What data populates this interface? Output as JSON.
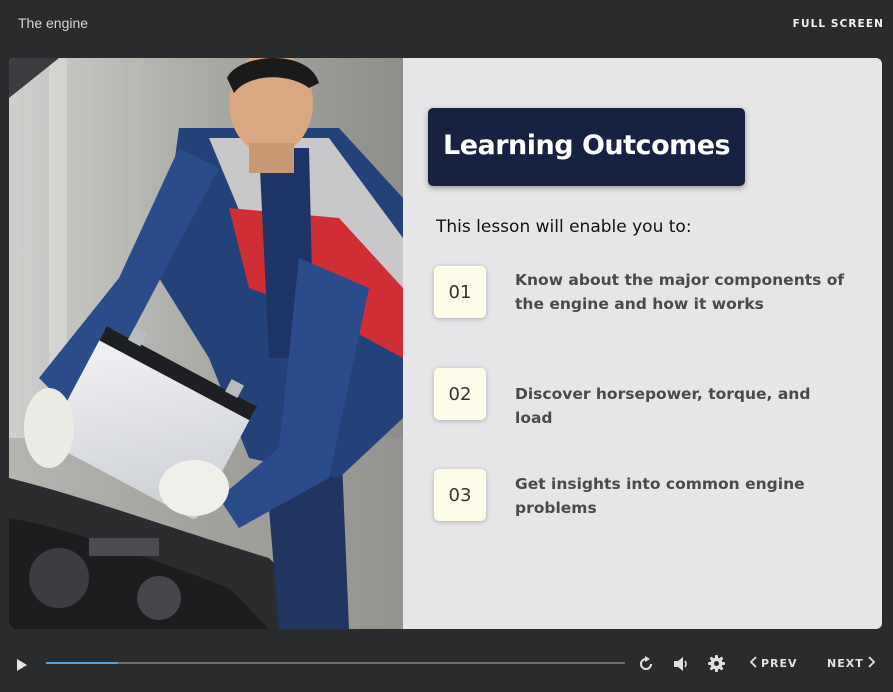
{
  "header": {
    "course_title": "The engine",
    "fullscreen_label": "FULL SCREEN"
  },
  "slide": {
    "heading": "Learning Outcomes",
    "intro": "This lesson will enable you to:",
    "outcomes": [
      {
        "number": "01",
        "text": "Know about the major components of the engine and how it works"
      },
      {
        "number": "02",
        "text": "Discover horsepower, torque, and load"
      },
      {
        "number": "03",
        "text": "Get insights into common engine problems"
      }
    ],
    "colors": {
      "heading_bg": "#172242",
      "number_bg": "#fdfce9",
      "slide_bg": "#e6e6e9"
    }
  },
  "player": {
    "progress": 0.125,
    "prev_label": "PREV",
    "next_label": "NEXT",
    "icons": [
      "play-icon",
      "replay-icon",
      "volume-icon",
      "settings-icon",
      "chevron-left-icon",
      "chevron-right-icon"
    ],
    "accent": "#5b9fd6"
  }
}
